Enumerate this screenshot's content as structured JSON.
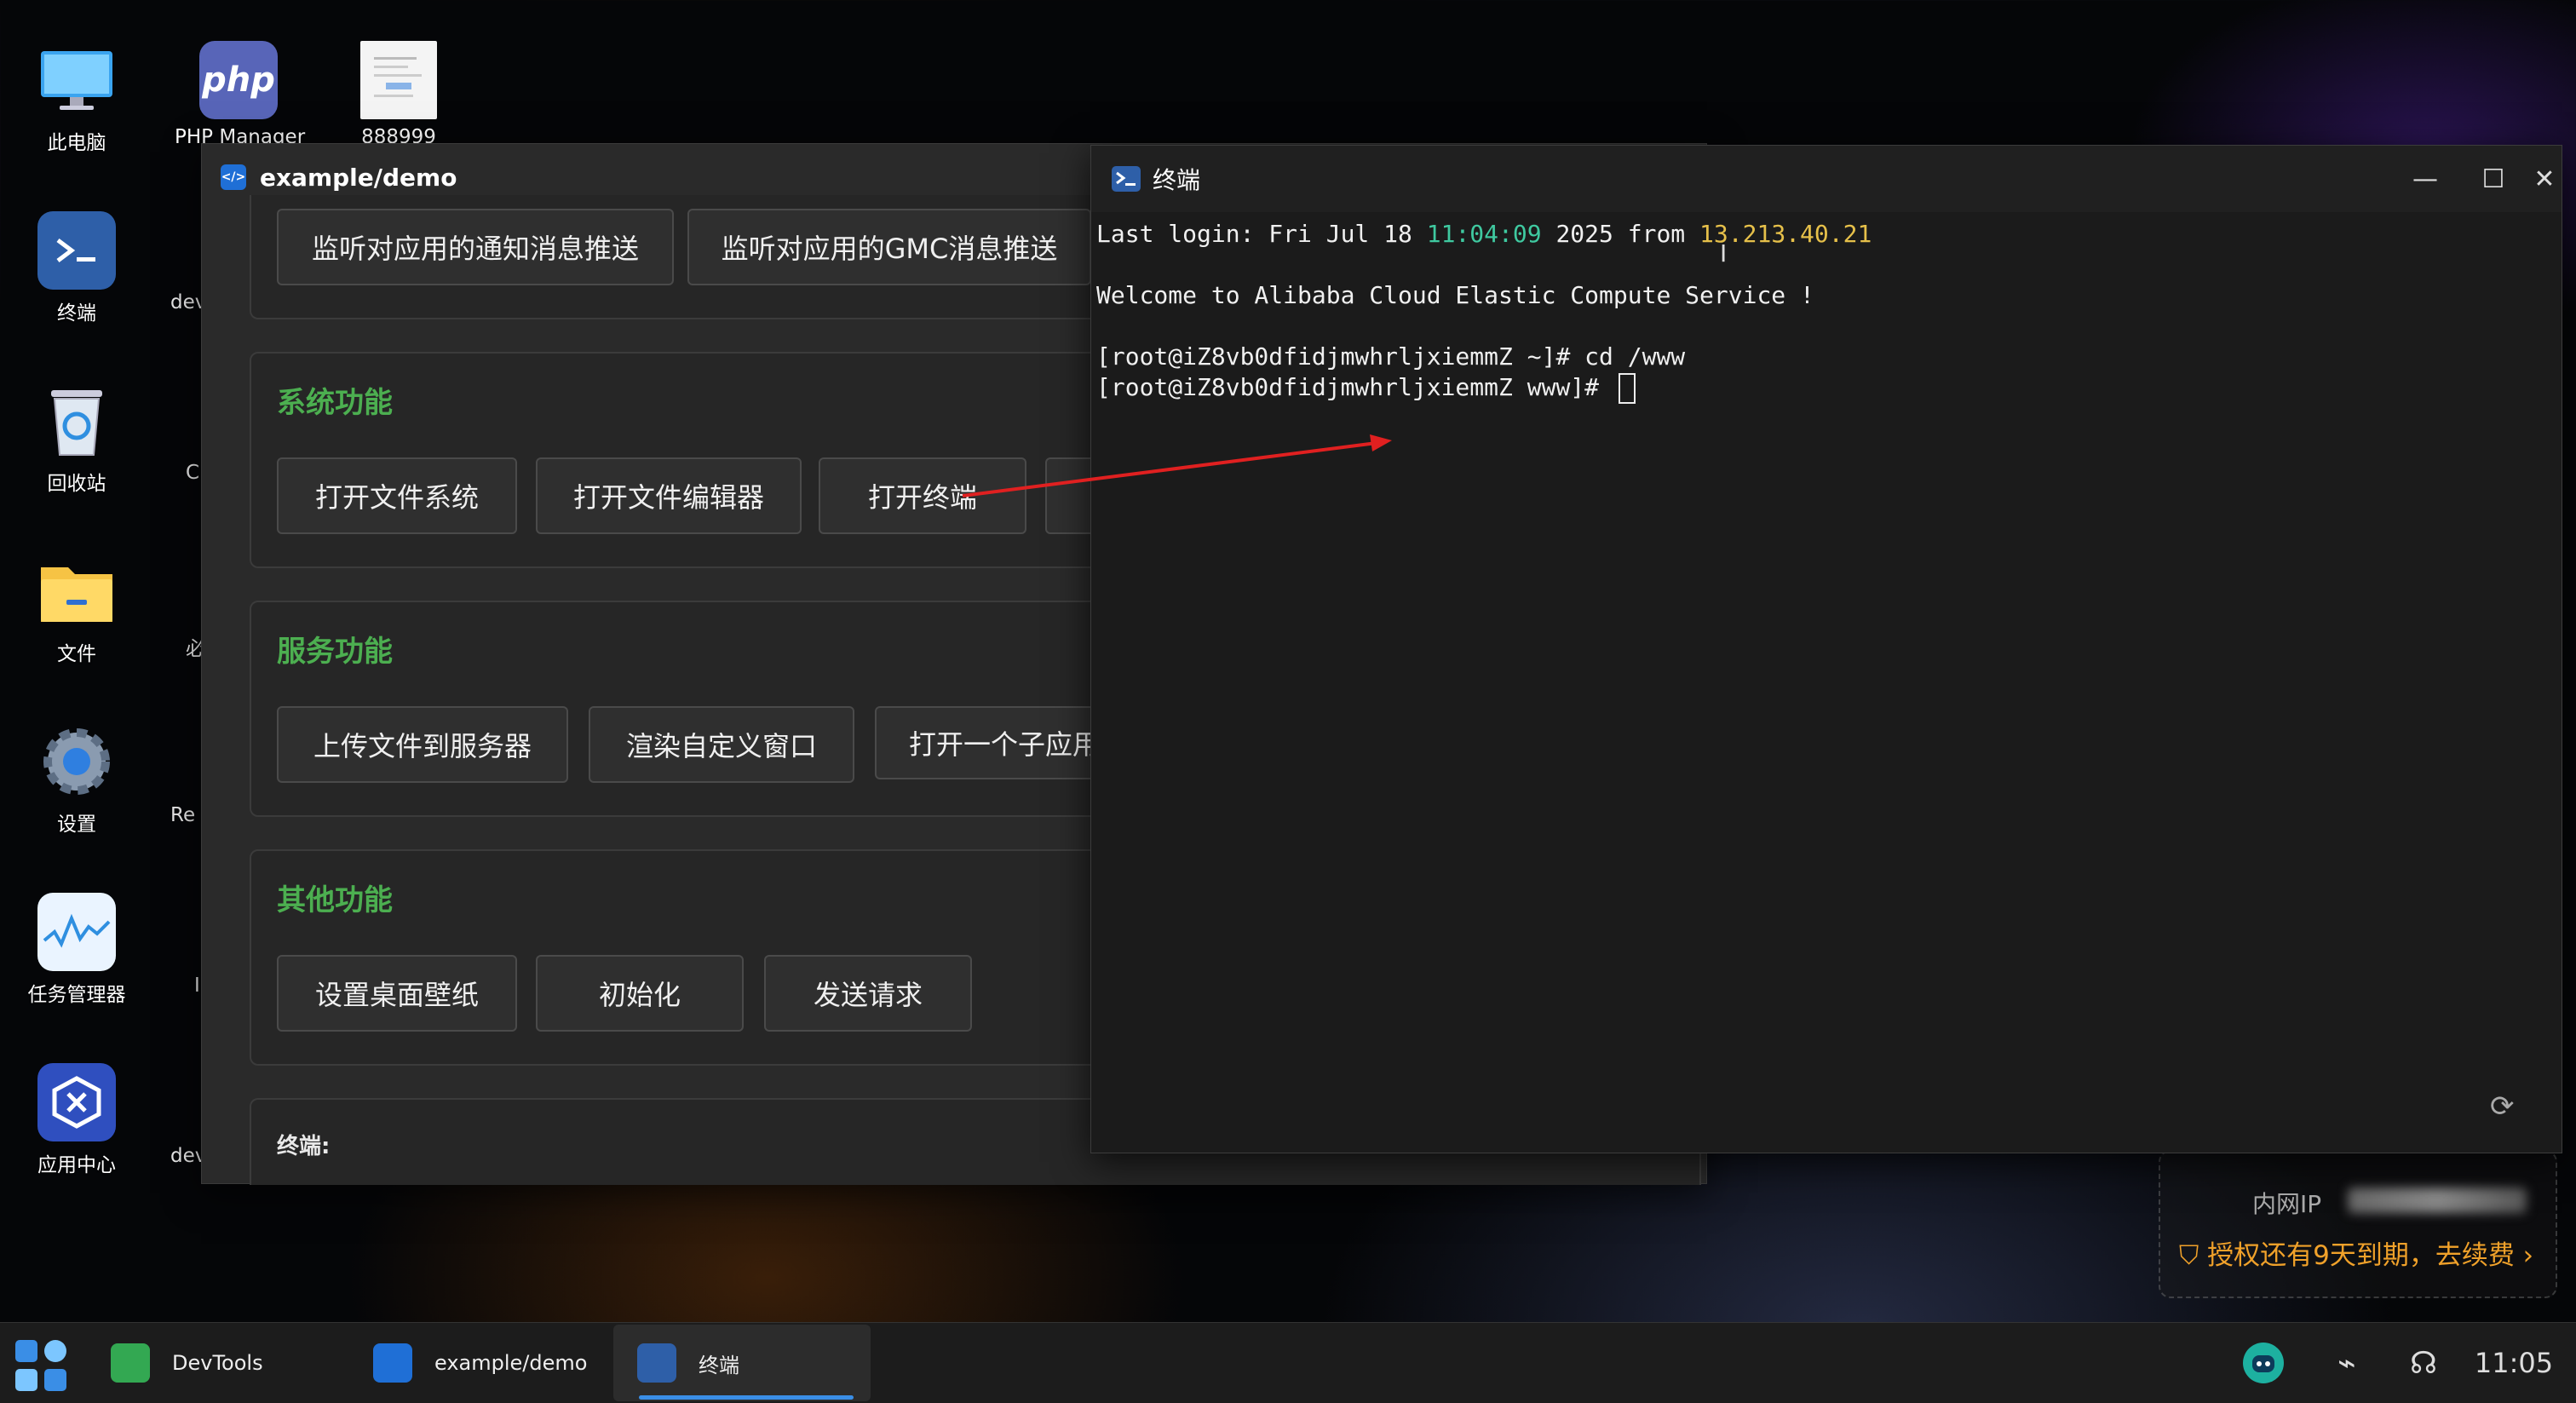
{
  "desktop": {
    "icons": [
      {
        "label": "此电脑"
      },
      {
        "label": "PHP Manager"
      },
      {
        "label": "888999"
      },
      {
        "label": "终端"
      },
      {
        "label": "回收站"
      },
      {
        "label": "文件"
      },
      {
        "label": "设置"
      },
      {
        "label": "任务管理器"
      },
      {
        "label": "应用中心"
      }
    ],
    "partial_labels": [
      "dev",
      "C",
      "必",
      "Re",
      "I",
      "devtoo"
    ]
  },
  "demo_window": {
    "title": "example/demo",
    "top_buttons": [
      "监听对应用的通知消息推送",
      "监听对应用的GMC消息推送"
    ],
    "sections": [
      {
        "title": "系统功能",
        "buttons": [
          "打开文件系统",
          "打开文件编辑器",
          "打开终端",
          ""
        ]
      },
      {
        "title": "服务功能",
        "buttons": [
          "上传文件到服务器",
          "渲染自定义窗口",
          "打开一个子应用"
        ]
      },
      {
        "title": "其他功能",
        "buttons": [
          "设置桌面壁纸",
          "初始化",
          "发送请求"
        ]
      }
    ],
    "footer_label": "终端:"
  },
  "terminal": {
    "title": "终端",
    "lines": {
      "login_prefix": "Last login: Fri Jul 18 ",
      "login_time": "11:04:09",
      "login_mid": " 2025 from ",
      "login_ip": "13.213.40.21",
      "welcome": "Welcome to Alibaba Cloud Elastic Compute Service !",
      "cmd1": "[root@iZ8vb0dfidjmwhrljxiemmZ ~]# cd /www",
      "cmd2": "[root@iZ8vb0dfidjmwhrljxiemmZ www]# "
    }
  },
  "widget": {
    "ip_label": "内网IP",
    "license_text": "授权还有9天到期，去续费 ›"
  },
  "taskbar": {
    "apps": [
      {
        "label": "DevTools"
      },
      {
        "label": "example/demo"
      },
      {
        "label": "终端"
      }
    ],
    "clock": "11:05"
  },
  "colors": {
    "section_title": "#4caf50",
    "terminal_green": "#3fc9a0",
    "terminal_yellow": "#e6c04a",
    "license_orange": "#f0a12a",
    "arrow": "#e02020",
    "taskbar_accent": "#3a8ee6"
  }
}
